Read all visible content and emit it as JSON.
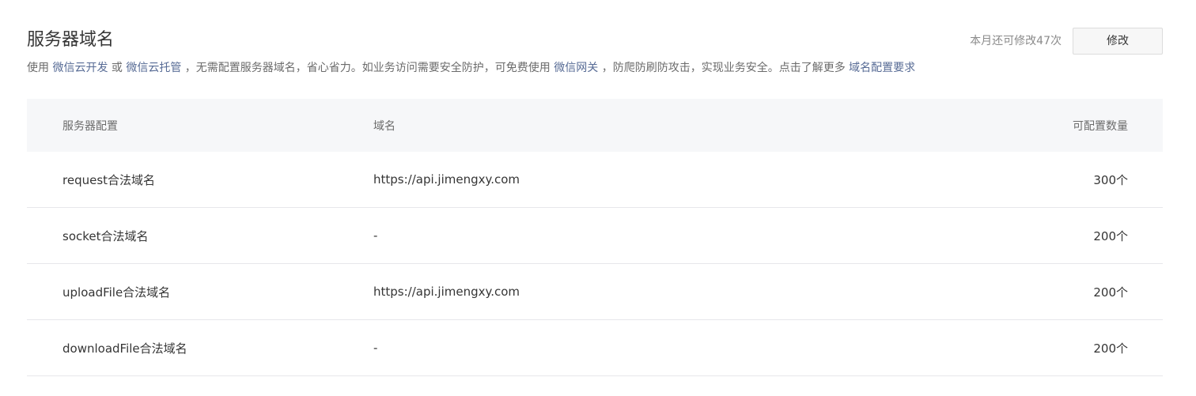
{
  "header": {
    "title": "服务器域名",
    "quota_text": "本月还可修改47次",
    "edit_button": "修改"
  },
  "description": {
    "part1": "使用 ",
    "link1": "微信云开发",
    "part2": " 或 ",
    "link2": "微信云托管",
    "part3": " ，无需配置服务器域名，省心省力。如业务访问需要安全防护，可免费使用 ",
    "link3": "微信网关",
    "part4": " ，防爬防刷防攻击，实现业务安全。点击了解更多 ",
    "link4": "域名配置要求"
  },
  "table": {
    "headers": [
      "服务器配置",
      "域名",
      "可配置数量"
    ],
    "rows": [
      {
        "config": "request合法域名",
        "domain": "https://api.jimengxy.com",
        "count": "300个"
      },
      {
        "config": "socket合法域名",
        "domain": "-",
        "count": "200个"
      },
      {
        "config": "uploadFile合法域名",
        "domain": "https://api.jimengxy.com",
        "count": "200个"
      },
      {
        "config": "downloadFile合法域名",
        "domain": "-",
        "count": "200个"
      }
    ]
  }
}
